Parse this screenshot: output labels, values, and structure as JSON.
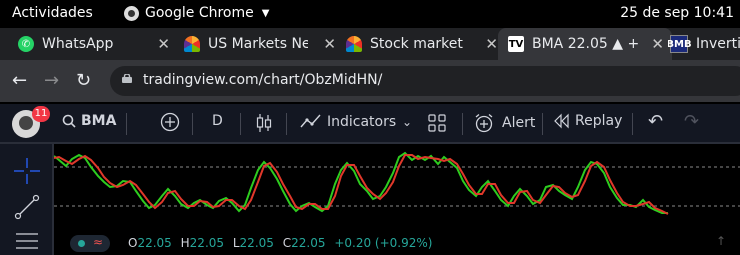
{
  "system_bar": {
    "activities": "Actividades",
    "app_name": "Google Chrome",
    "clock": "25 de sep  10:41"
  },
  "tabs": [
    {
      "title": "WhatsApp",
      "favicon": "whatsapp-logo",
      "active": false
    },
    {
      "title": "US Markets Ne",
      "favicon": "nbc-peacock",
      "active": false
    },
    {
      "title": "Stock market",
      "favicon": "nbc-peacock",
      "active": false
    },
    {
      "title": "BMA 22.05 ▲ +",
      "favicon": "tradingview-logo",
      "active": true
    },
    {
      "title": "Invertir",
      "favicon": "bmb-logo",
      "active": false
    }
  ],
  "address_bar": {
    "url": "tradingview.com/chart/ObzMidHN/"
  },
  "tv_toolbar": {
    "notification_count": "11",
    "symbol": "BMA",
    "interval": "D",
    "indicators_label": "Indicators",
    "alert_label": "Alert",
    "replay_label": "Replay"
  },
  "legend": {
    "open_label": "O",
    "open": "22.05",
    "high_label": "H",
    "high": "22.05",
    "low_label": "L",
    "low": "22.05",
    "close_label": "C",
    "close": "22.05",
    "change": "+0.20 (+0.92%)"
  },
  "colors": {
    "green_line": "#2ecc1f",
    "red_line": "#e0382a",
    "up": "#26a69a",
    "dashed": "#8a8a8a"
  }
}
